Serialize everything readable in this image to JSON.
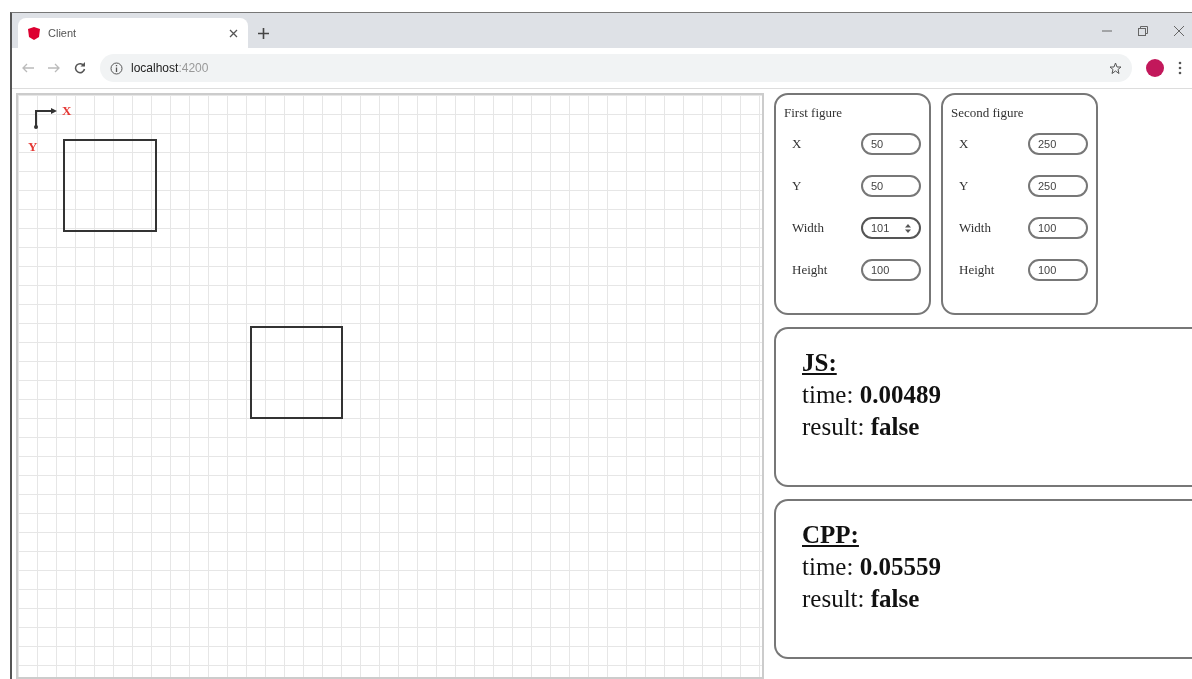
{
  "browser": {
    "tab": {
      "title": "Client",
      "selected": true
    },
    "url": {
      "host": "localhost",
      "port": ":4200"
    }
  },
  "canvas": {
    "axis_x": "X",
    "axis_y": "Y"
  },
  "figures": [
    {
      "title": "First figure",
      "fields": [
        {
          "label": "X",
          "value": "50",
          "focused": false
        },
        {
          "label": "Y",
          "value": "50",
          "focused": false
        },
        {
          "label": "Width",
          "value": "101",
          "focused": true
        },
        {
          "label": "Height",
          "value": "100",
          "focused": false
        }
      ]
    },
    {
      "title": "Second figure",
      "fields": [
        {
          "label": "X",
          "value": "250",
          "focused": false
        },
        {
          "label": "Y",
          "value": "250",
          "focused": false
        },
        {
          "label": "Width",
          "value": "100",
          "focused": false
        },
        {
          "label": "Height",
          "value": "100",
          "focused": false
        }
      ]
    }
  ],
  "results": [
    {
      "title": "JS:",
      "lines": [
        "time: **0.00489**",
        "result: **false**"
      ]
    },
    {
      "title": "CPP:",
      "lines": [
        "time: **0.05559**",
        "result: **false**"
      ]
    }
  ]
}
